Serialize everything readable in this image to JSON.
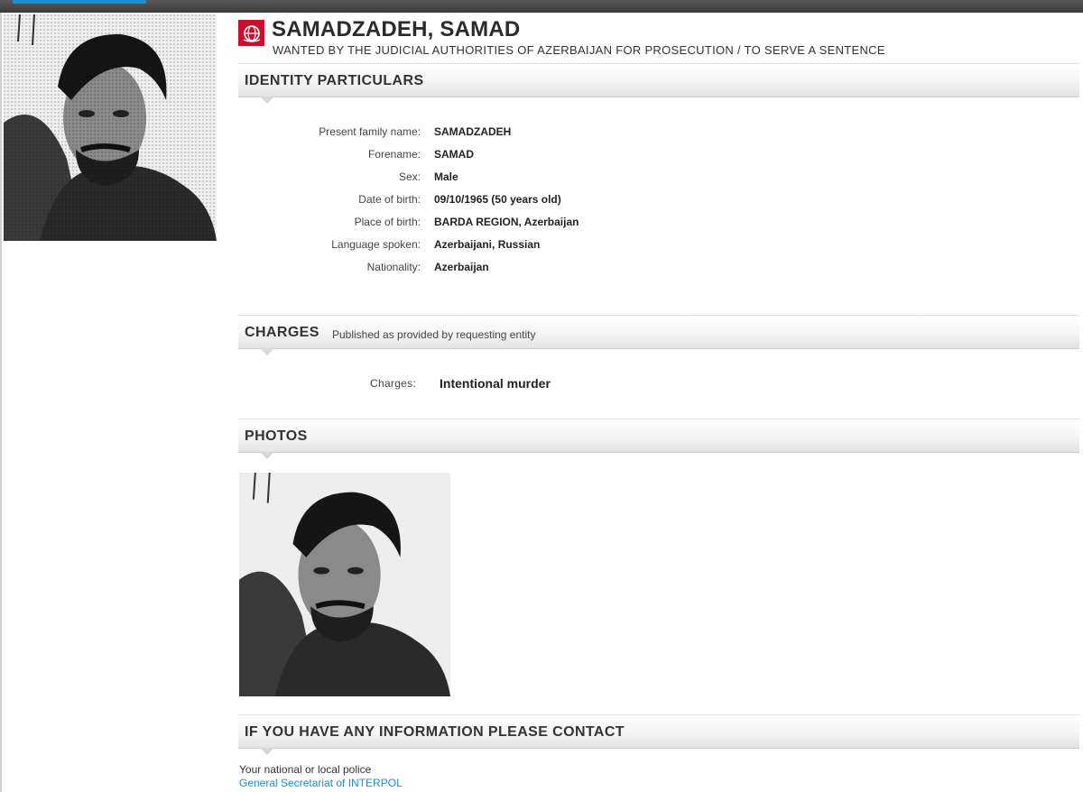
{
  "notice": {
    "name": "SAMADZADEH, SAMAD",
    "subtitle": "WANTED BY THE JUDICIAL AUTHORITIES OF AZERBAIJAN FOR PROSECUTION / TO SERVE A SENTENCE",
    "emblem_icon": "interpol-emblem-icon",
    "emblem_color": "#c8102e"
  },
  "identity": {
    "heading": "IDENTITY PARTICULARS",
    "fields": [
      {
        "label": "Present family name:",
        "value": "SAMADZADEH"
      },
      {
        "label": "Forename:",
        "value": "SAMAD"
      },
      {
        "label": "Sex:",
        "value": "Male"
      },
      {
        "label": "Date of birth:",
        "value": "09/10/1965 (50 years old)"
      },
      {
        "label": "Place of birth:",
        "value": "BARDA REGION, Azerbaijan"
      },
      {
        "label": "Language spoken:",
        "value": "Azerbaijani, Russian"
      },
      {
        "label": "Nationality:",
        "value": "Azerbaijan"
      }
    ]
  },
  "charges": {
    "heading": "CHARGES",
    "note": "Published as provided by requesting entity",
    "label": "Charges:",
    "value": "Intentional murder"
  },
  "photos": {
    "heading": "PHOTOS"
  },
  "contact": {
    "heading": "IF YOU HAVE ANY INFORMATION PLEASE CONTACT",
    "line1": "Your national or local police",
    "link_text": "General Secretariat of INTERPOL",
    "link_color": "#1a8fd6"
  }
}
